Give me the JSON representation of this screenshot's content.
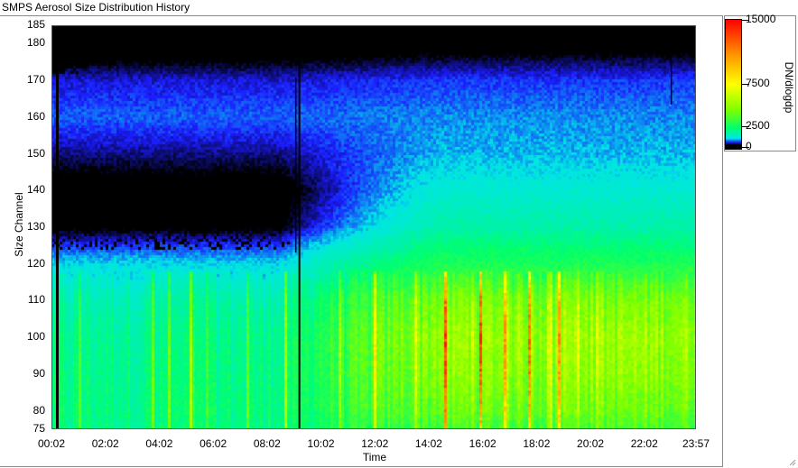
{
  "window": {
    "title": "SMPS Aerosol Size Distribution History"
  },
  "chart_data": {
    "type": "heatmap",
    "title": "",
    "xlabel": "Time",
    "ylabel": "Size Channel",
    "x_ticks": [
      "00:02",
      "02:02",
      "04:02",
      "06:02",
      "08:02",
      "10:02",
      "12:02",
      "14:02",
      "16:02",
      "18:02",
      "20:02",
      "22:02",
      "23:57"
    ],
    "y_ticks": [
      185,
      180,
      170,
      160,
      150,
      140,
      130,
      120,
      110,
      100,
      90,
      80,
      75
    ],
    "ylim": [
      75,
      185
    ],
    "xlim": [
      "00:02",
      "23:57"
    ],
    "colorbar": {
      "label": "DN/dlogdp",
      "ticks": [
        {
          "value": 15000,
          "label": "15000"
        },
        {
          "value": 7500,
          "label": "7500"
        },
        {
          "value": 2500,
          "label": "2500"
        },
        {
          "value": 0,
          "label": "0"
        }
      ],
      "colors": [
        "#000000",
        "#1c1cff",
        "#00e5e5",
        "#00ff6e",
        "#7dff00",
        "#ffff00",
        "#ff9900",
        "#ff0000"
      ]
    },
    "profile_channels": [
      75,
      80,
      90,
      100,
      110,
      120,
      130,
      140,
      150,
      160,
      170,
      180,
      185
    ],
    "profile_values_morning": [
      2200,
      2300,
      2200,
      2100,
      1800,
      1200,
      400,
      300,
      600,
      900,
      700,
      200,
      0
    ],
    "profile_values_afternoon": [
      3500,
      4200,
      4800,
      5200,
      4500,
      2800,
      1800,
      1400,
      1100,
      1000,
      800,
      300,
      0
    ],
    "gaps": [
      "00:15",
      "09:06",
      "09:14",
      "23:02"
    ]
  }
}
